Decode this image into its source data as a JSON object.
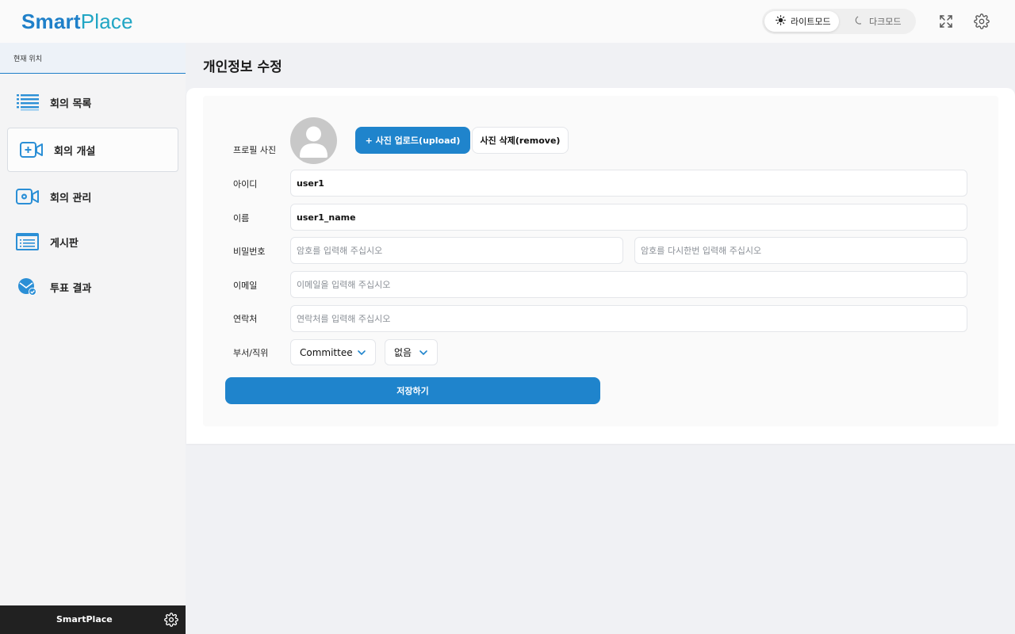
{
  "app": {
    "logo_smart": "Smart",
    "logo_place": "Place",
    "brand_color": "#1f80c9"
  },
  "header": {
    "light_mode_label": "라이트모드",
    "dark_mode_label": "다크모드",
    "active_mode": "light",
    "icons": [
      "sun-icon",
      "moon-icon",
      "fullscreen-icon",
      "gear-icon"
    ]
  },
  "sidebar": {
    "breadcrumb": "현재 위치",
    "items": [
      {
        "label": "회의 목록",
        "icon": "list-icon",
        "active": false
      },
      {
        "label": "회의 개설",
        "icon": "video-add-icon",
        "active": true
      },
      {
        "label": "회의 관리",
        "icon": "video-settings-icon",
        "active": false
      },
      {
        "label": "게시판",
        "icon": "board-icon",
        "active": false
      },
      {
        "label": "투표 결과",
        "icon": "vote-icon",
        "active": false
      }
    ],
    "footer_title": "SmartPlace"
  },
  "main": {
    "title": "개인정보 수정",
    "form": {
      "photo_label": "프로필 사진",
      "upload_label": "+ 사진 업로드(upload)",
      "remove_label": "사진 삭제(remove)",
      "id_label": "아이디",
      "id_value": "user1",
      "name_label": "이름",
      "name_value": "user1_name",
      "password_label": "비밀번호",
      "password_placeholder": "암호를 입력해 주십시오",
      "password_confirm_placeholder": "암호를 다시한번 입력해 주십시오",
      "email_label": "이메일",
      "email_placeholder": "이메일을 입력해 주십시오",
      "phone_label": "연락처",
      "phone_placeholder": "연락처를 입력해 주십시오",
      "dept_label": "부서/직위",
      "dept_value": "Committee",
      "position_value": "없음",
      "save_label": "저장하기"
    }
  }
}
